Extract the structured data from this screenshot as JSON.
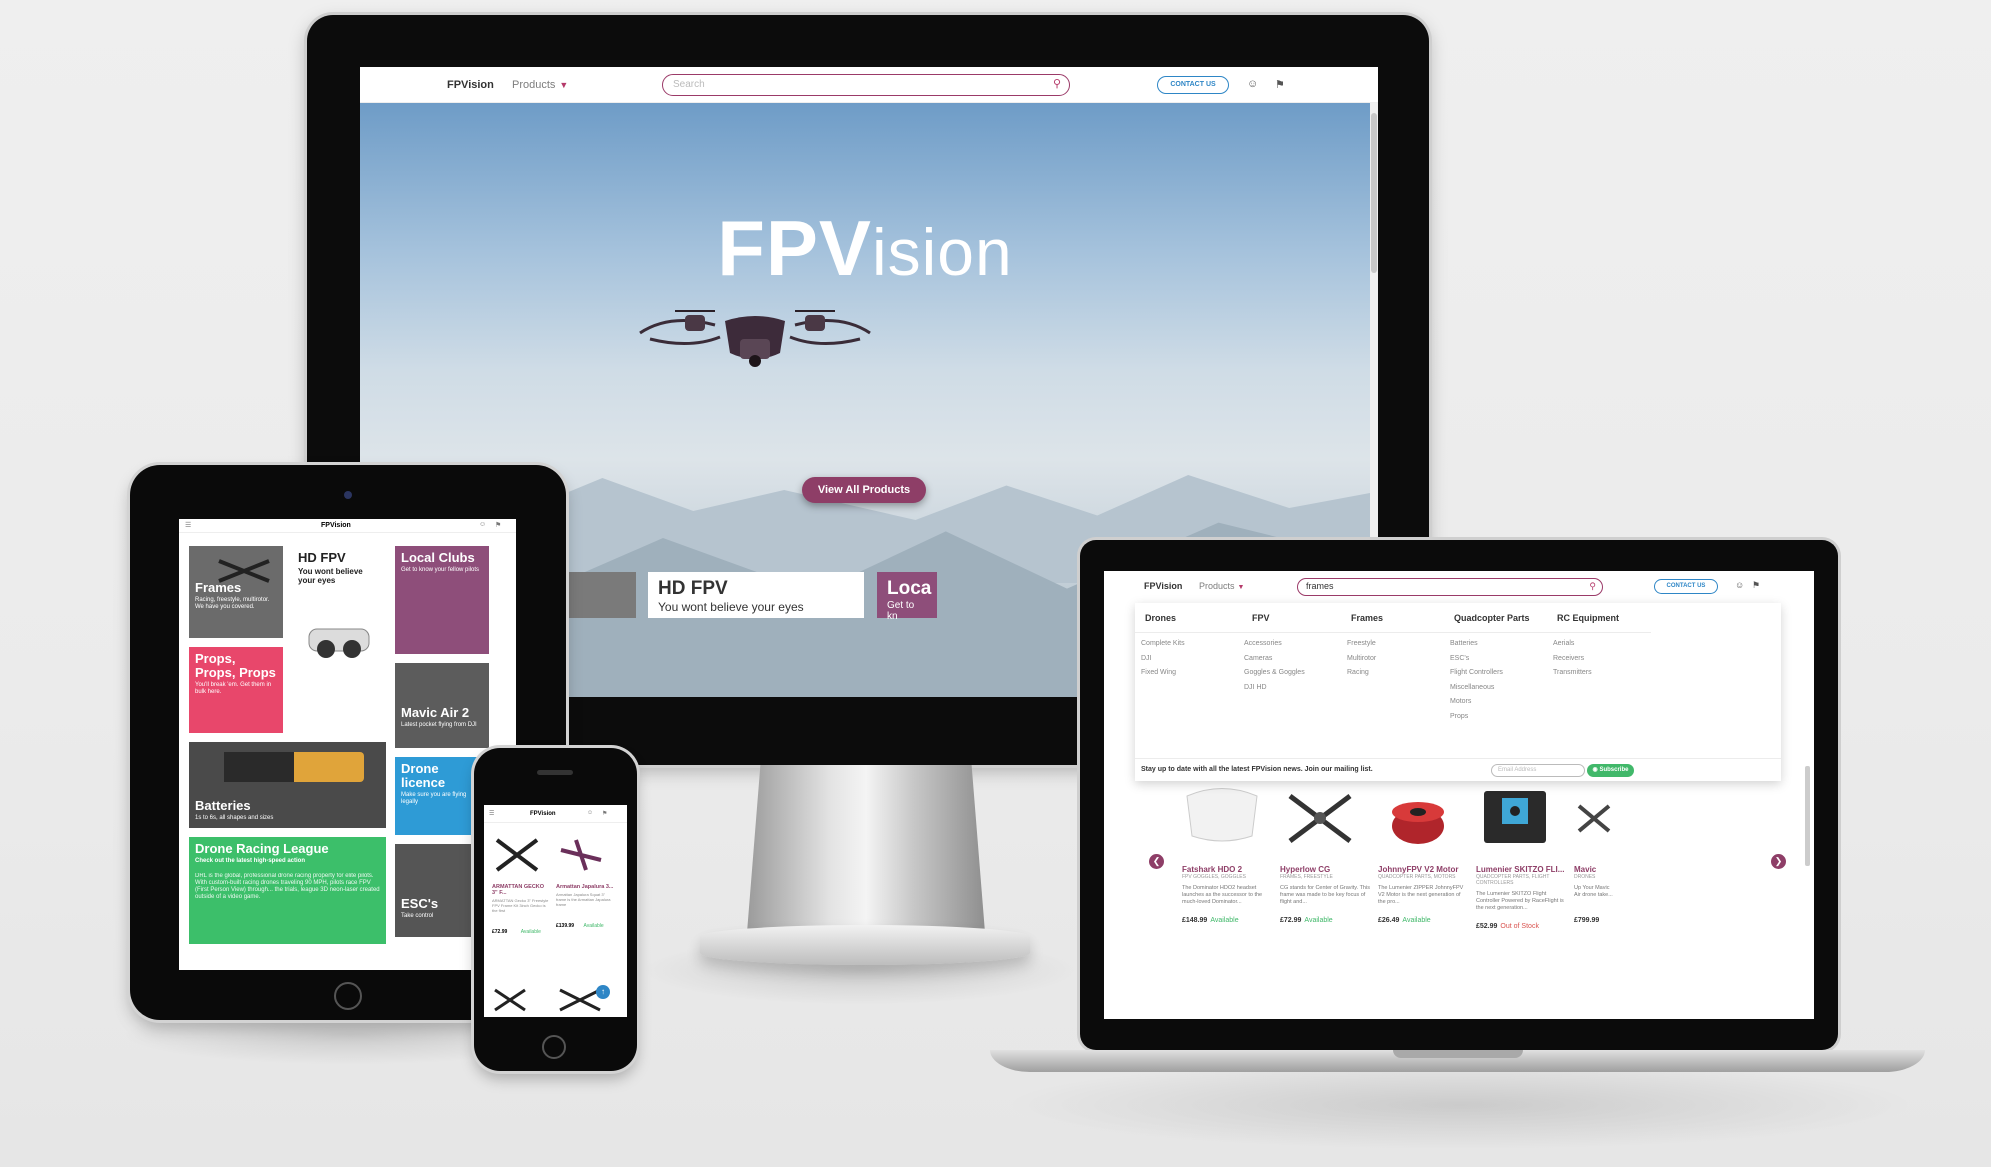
{
  "desktop": {
    "nav": {
      "brand": "FPVision",
      "products_label": "Products",
      "search_placeholder": "Search",
      "contact_label": "CONTACT US"
    },
    "hero": {
      "title_bold": "FPV",
      "title_thin": "ision",
      "cta_label": "View All Products"
    },
    "cards": [
      {
        "title": "HD FPV",
        "subtitle": "You wont believe your eyes"
      },
      {
        "title": "Loca",
        "subtitle": "Get to kn"
      }
    ]
  },
  "tablet": {
    "nav": {
      "brand": "FPVision"
    },
    "tiles": [
      {
        "title": "Frames",
        "subtitle": "Racing, freestyle, multirotor. We have you covered.",
        "color": "#6b6b6b"
      },
      {
        "title": "HD FPV",
        "subtitle": "You wont believe your eyes",
        "color": "#ffffff"
      },
      {
        "title": "Local Clubs",
        "subtitle": "Get to know your fellow pilots",
        "color": "#8e4e7a"
      },
      {
        "title": "Props, Props, Props",
        "subtitle": "You'll break 'em. Get them in bulk here.",
        "color": "#e8476b"
      },
      {
        "title": "Mavic Air 2",
        "subtitle": "Latest pocket flying from DJI",
        "color": "#5c5c5c"
      },
      {
        "title": "Batteries",
        "subtitle": "1s to 6s, all shapes and sizes",
        "color": "#4a4a4a"
      },
      {
        "title": "Drone licence",
        "subtitle": "Make sure you are flying legally",
        "color": "#2e9bd6"
      },
      {
        "title": "Drone Racing League",
        "subtitle": "Check out the latest high-speed action",
        "body": "DRL is the global, professional drone racing property for elite pilots. With custom-built racing drones traveling 90 MPH, pilots race FPV (First Person View) through... the trials, league 3D neon-laser created outside of a video game.",
        "color": "#3cbf6a"
      },
      {
        "title": "ESC's",
        "subtitle": "Take control",
        "color": "#555555"
      }
    ]
  },
  "phone": {
    "nav": {
      "brand": "FPVision"
    },
    "products": [
      {
        "name": "ARMATTAN GECKO 3\" F...",
        "desc": "ARMATTAN Gecko 3\" Freestyle FPV Frame Kit 3inch Gecko is the first",
        "price": "£72.99",
        "status": "Available"
      },
      {
        "name": "Armattan Japalura 3...",
        "desc": "Armattan Japalura Squat 3\" frame is the Armattan Japalura frame",
        "price": "£139.99",
        "status": "Available"
      }
    ]
  },
  "laptop": {
    "nav": {
      "brand": "FPVision",
      "products_label": "Products",
      "search_value": "frames",
      "contact_label": "CONTACT US"
    },
    "mega_menu": {
      "columns": [
        {
          "heading": "Drones",
          "items": [
            "Complete Kits",
            "DJI",
            "Fixed Wing"
          ]
        },
        {
          "heading": "FPV",
          "items": [
            "Accessories",
            "Cameras",
            "Goggles & Goggles",
            "DJI HD"
          ]
        },
        {
          "heading": "Frames",
          "items": [
            "Freestyle",
            "Multirotor",
            "Racing"
          ]
        },
        {
          "heading": "Quadcopter Parts",
          "items": [
            "Batteries",
            "ESC's",
            "Flight Controllers",
            "Miscellaneous",
            "Motors",
            "Props"
          ]
        },
        {
          "heading": "RC Equipment",
          "items": [
            "Aerials",
            "Receivers",
            "Transmitters"
          ]
        }
      ],
      "newsletter_text": "Stay up to date with all the latest FPVision news. Join our mailing list.",
      "email_placeholder": "Email Address",
      "subscribe_label": "Subscribe"
    },
    "products": [
      {
        "name": "Fatshark HDO 2",
        "category": "FPV GOGGLES, GOGGLES",
        "desc": "The Dominator HDO2 headset launches as the successor to the much-loved Dominator...",
        "price": "£148.99",
        "status": "Available"
      },
      {
        "name": "Hyperlow CG",
        "category": "FRAMES, FREESTYLE",
        "desc": "CG stands for Center of Gravity. This frame was made to be key focus of flight and...",
        "price": "£72.99",
        "status": "Available"
      },
      {
        "name": "JohnnyFPV V2 Motor",
        "category": "QUADCOPTER PARTS, MOTORS",
        "desc": "The Lumenier ZIPPER JohnnyFPV V2 Motor is the next generation of the pro...",
        "price": "£26.49",
        "status": "Available"
      },
      {
        "name": "Lumenier SKITZO FLI...",
        "category": "QUADCOPTER PARTS, FLIGHT CONTROLLERS",
        "desc": "The Lumenier SKITZO Flight Controller Powered by RaceFlight is the next generation...",
        "price": "£52.99",
        "status": "Out of Stock"
      },
      {
        "name": "Mavic",
        "category": "DRONES",
        "desc": "Up Your Mavic Air drone take...",
        "price": "£799.99",
        "status": ""
      }
    ]
  },
  "colors": {
    "brand_purple": "#8e3e67",
    "accent_blue": "#2e86c6",
    "available_green": "#41b86a",
    "out_of_stock_red": "#d9534f"
  }
}
